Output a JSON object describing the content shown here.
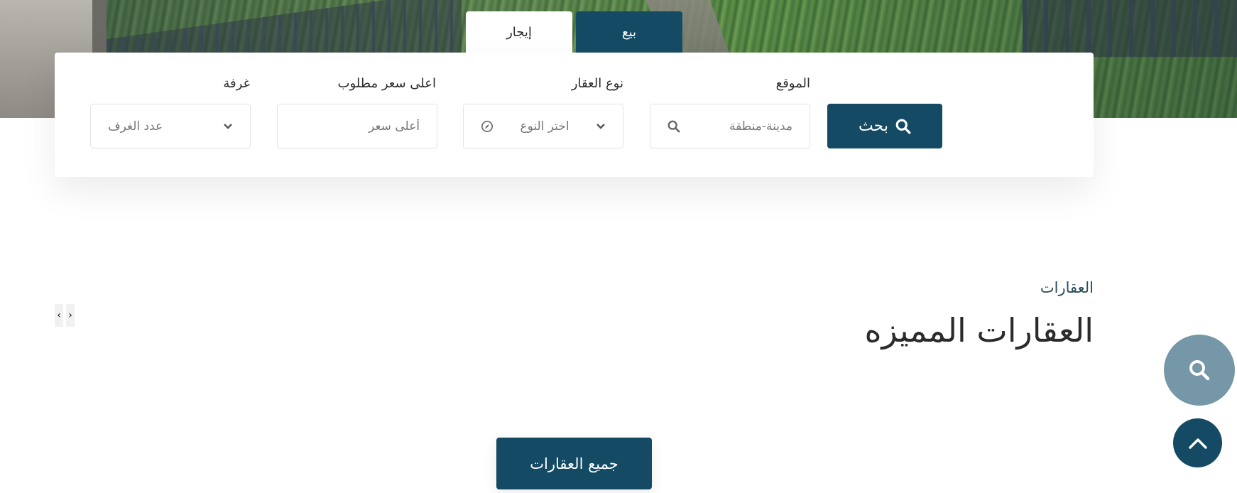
{
  "tabs": [
    {
      "label": "بيع",
      "active": true
    },
    {
      "label": "إيجار",
      "active": false
    }
  ],
  "search": {
    "button_label": "بحث",
    "fields": {
      "location": {
        "label": "الموقع",
        "placeholder": "مدينة-منطقة",
        "icon": "search-icon"
      },
      "type": {
        "label": "نوع العقار",
        "placeholder": "اختر النوع",
        "icon": "compass-icon"
      },
      "max_price": {
        "label": "اعلى سعر مطلوب",
        "placeholder": "أعلى سعر"
      },
      "rooms": {
        "label": "غرفة",
        "placeholder": "عدد الغرف"
      }
    }
  },
  "featured": {
    "kicker": "العقارات",
    "title": "العقارات المميزه",
    "all_button": "جميع العقارات"
  },
  "slider": {
    "prev": "‹",
    "next": "›"
  },
  "colors": {
    "primary": "#144a63",
    "fab_search": "#7697a8"
  }
}
